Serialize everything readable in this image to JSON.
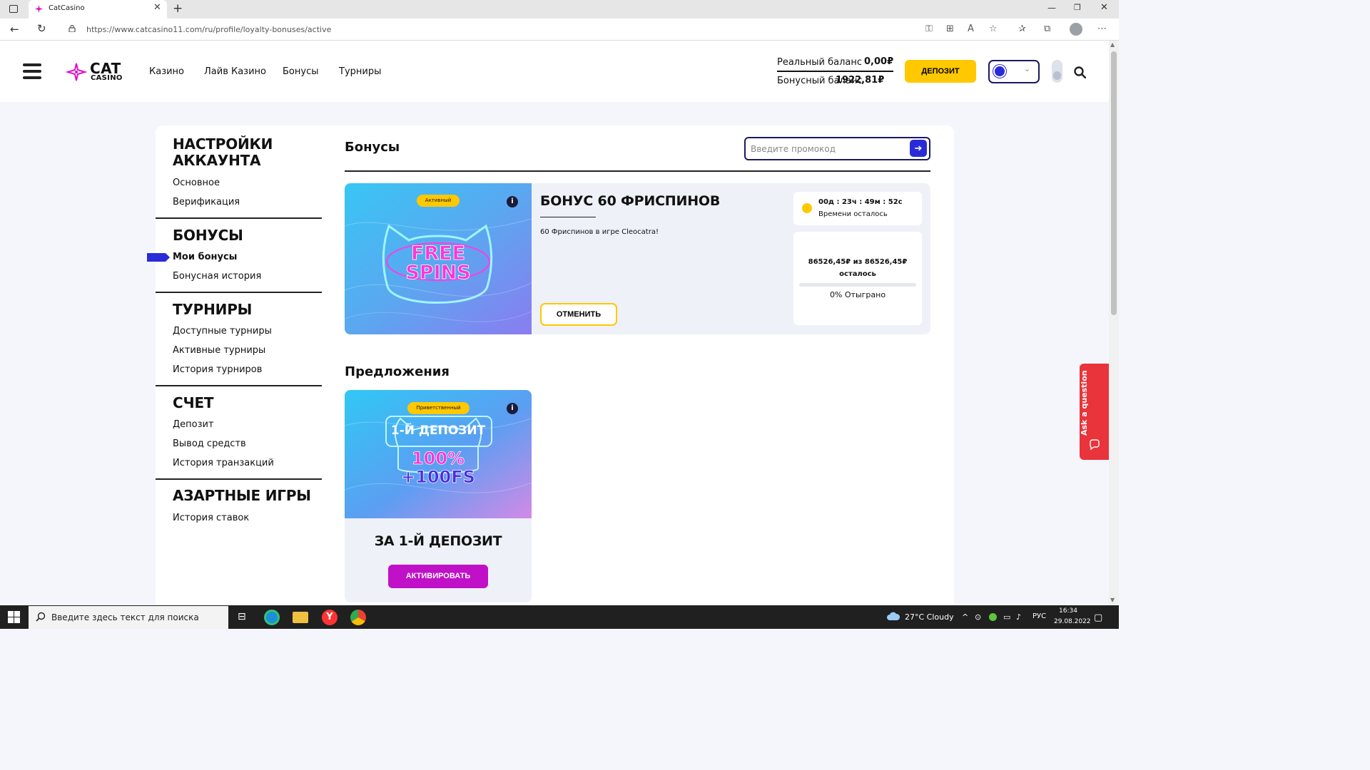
{
  "browser": {
    "tab_title": "CatCasino",
    "url": "https://www.catcasino11.com/ru/profile/loyalty-bonuses/active"
  },
  "site": {
    "logo_top": "CAT",
    "logo_bottom": "CASINO",
    "nav": [
      "Казино",
      "Лайв Казино",
      "Бонусы",
      "Турниры"
    ],
    "balance": {
      "real_label": "Реальный баланс",
      "real_value": "0,00₽",
      "bonus_label": "Бонусный баланс",
      "bonus_value": "1922,81₽"
    },
    "deposit_label": "ДЕПОЗИТ"
  },
  "sidebar": {
    "sections": [
      {
        "title": "НАСТРОЙКИ АККАУНТА",
        "items": [
          "Основное",
          "Верификация"
        ]
      },
      {
        "title": "БОНУСЫ",
        "items": [
          "Мои бонусы",
          "Бонусная история"
        ],
        "active_item": "Мои бонусы"
      },
      {
        "title": "ТУРНИРЫ",
        "items": [
          "Доступные турниры",
          "Активные турниры",
          "История турниров"
        ]
      },
      {
        "title": "СЧЕТ",
        "items": [
          "Депозит",
          "Вывод средств",
          "История транзакций"
        ]
      },
      {
        "title": "АЗАРТНЫЕ ИГРЫ",
        "items": [
          "История ставок"
        ]
      }
    ]
  },
  "main": {
    "title": "Бонусы",
    "promo_placeholder": "Введите промокод",
    "active_bonus": {
      "badge": "Активный",
      "image_text_1": "FREE",
      "image_text_2": "SPINS",
      "title": "БОНУС 60 ФРИСПИНОВ",
      "description": "60 Фриспинов в игре Cleocatra!",
      "cancel_label": "ОТМЕНИТЬ",
      "timer": "00д : 23ч : 49м : 52с",
      "timer_label": "Времени осталось",
      "wager_amount": "86526,45₽ из 86526,45₽",
      "wager_remaining_label": "осталось",
      "wager_played": "0% Отыграно",
      "wager_progress": 0
    },
    "offers_title": "Предложения",
    "offer": {
      "badge": "Приветственный",
      "image_text_1": "1-Й ДЕПОЗИТ",
      "image_text_2": "100%",
      "image_text_3": "+100FS",
      "title": "ЗА 1-Й ДЕПОЗИТ",
      "activate_label": "АКТИВИРОВАТЬ"
    }
  },
  "ask_question": "Ask a question",
  "taskbar": {
    "search_placeholder": "Введите здесь текст для поиска",
    "weather": "27°C  Cloudy",
    "lang": "РУС",
    "time": "16:34",
    "date": "29.08.2022"
  },
  "colors": {
    "accent_yellow": "#ffc800",
    "accent_blue": "#2a2bd8",
    "accent_magenta": "#c010c8",
    "ask_red": "#e8343a"
  }
}
